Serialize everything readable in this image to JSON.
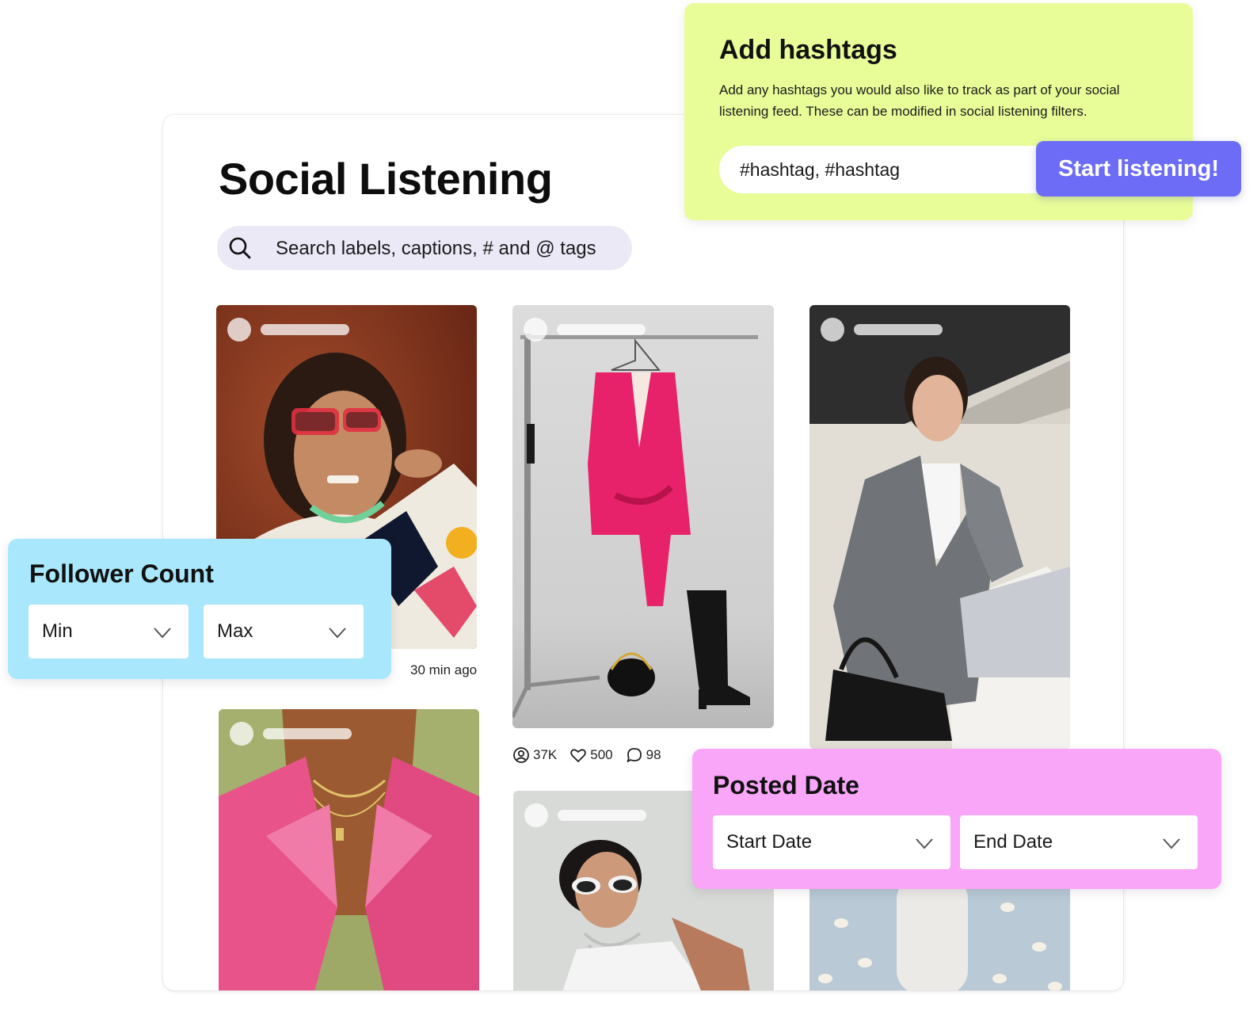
{
  "app": {
    "title": "Social Listening",
    "search_placeholder": "Search labels, captions, # and @ tags"
  },
  "posts": [
    {
      "name": "post-card-red-glasses",
      "time": "30 min ago"
    },
    {
      "name": "post-card-pink-blazer-rack",
      "stats": {
        "followers": "37K",
        "likes": "500",
        "comments": "98"
      }
    },
    {
      "name": "post-card-gray-blazer"
    },
    {
      "name": "post-card-pink-satin"
    },
    {
      "name": "post-card-sunglasses"
    },
    {
      "name": "post-card-bottle"
    }
  ],
  "hashtags": {
    "title": "Add hashtags",
    "description": "Add any hashtags you would also like to track as part of your social listening feed. These can be modified in social listening filters.",
    "input_placeholder": "#hashtag, #hashtag",
    "button_label": "Start listening!"
  },
  "follower_count": {
    "title": "Follower Count",
    "min_label": "Min",
    "max_label": "Max"
  },
  "posted_date": {
    "title": "Posted Date",
    "start_label": "Start Date",
    "end_label": "End Date"
  },
  "colors": {
    "hashtag_card": "#e8fd98",
    "follower_card": "#a9e8fc",
    "date_card": "#f9a5f8",
    "accent_button": "#6c6cf6",
    "search_bg": "#ebe9f6"
  },
  "icons": [
    "search-icon",
    "chevron-down-icon",
    "user-circle-icon",
    "heart-icon",
    "comment-icon"
  ]
}
